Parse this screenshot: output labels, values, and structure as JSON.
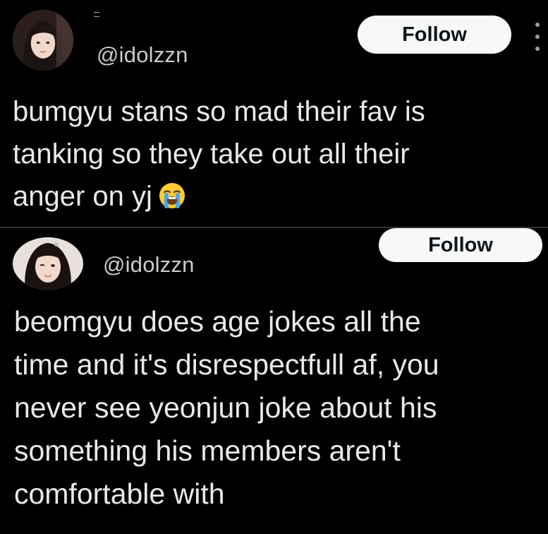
{
  "tweets": [
    {
      "handle": "@idolzzn",
      "follow_label": "Follow",
      "text_lines": [
        "bumgyu  stans so mad their fav is",
        "tanking so they take out all their",
        "anger on yj"
      ],
      "emoji": "loudly-crying-face"
    },
    {
      "handle": "@idolzzn",
      "follow_label": "Follow",
      "text_lines": [
        "beomgyu does age jokes all the",
        "time and it's disrespectfull af, you",
        "never see yeonjun joke about his",
        "something his members aren't",
        "comfortable with"
      ]
    }
  ],
  "colors": {
    "background": "#000000",
    "text": "#e7e9ea",
    "handle": "#c9ccce",
    "button_bg": "#f7f9f9",
    "button_text": "#0f1419"
  }
}
